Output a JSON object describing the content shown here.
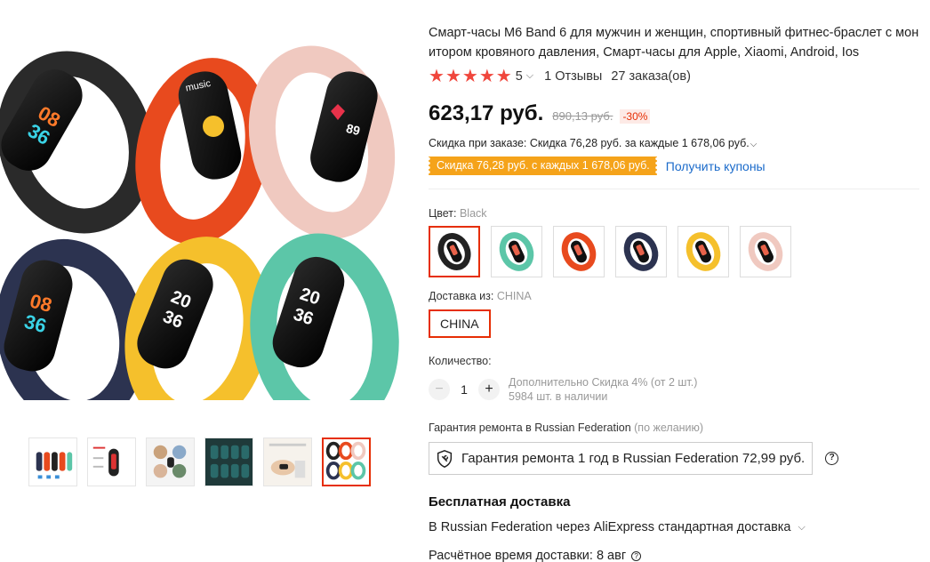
{
  "product": {
    "title": "Смарт-часы M6 Band 6 для мужчин и женщин, спортивный фитнес-браслет с мониторинг кровяного давления, Смарт-часы для Apple, Xiaomi, Android, Ios",
    "title_line1": "Смарт-часы M6 Band 6 для мужчин и женщин, спортивный фитнес-браслет с мон",
    "title_line2": "итором кровяного давления, Смарт-часы для Apple, Xiaomi, Android, Ios",
    "rating": "5",
    "reviews": "1 Отзывы",
    "orders": "27 заказа(ов)"
  },
  "price": {
    "current": "623,17 руб.",
    "old": "890,13 руб.",
    "discount": "-30%"
  },
  "order_discount": "Скидка при заказе: Скидка 76,28 руб. за каждые 1 678,06 руб.",
  "coupon": {
    "tag": "Скидка 76,28 руб. с каждых 1 678,06 руб.",
    "link": "Получить купоны"
  },
  "color": {
    "label": "Цвет:",
    "selected": "Black",
    "options": [
      "Black",
      "Mint",
      "Orange",
      "Navy",
      "Yellow",
      "Pink"
    ],
    "colors": [
      "#222222",
      "#5cc6a8",
      "#e84a1e",
      "#2c3350",
      "#f5c02c",
      "#f0c9c0"
    ]
  },
  "shipping_from": {
    "label": "Доставка из:",
    "selected": "CHINA",
    "option": "CHINA"
  },
  "quantity": {
    "label": "Количество:",
    "value": "1",
    "minus": "−",
    "plus": "+",
    "bulk_discount": "Дополнительно Скидка 4% (от 2 шт.)",
    "stock": "5984 шт. в наличии"
  },
  "warranty": {
    "label": "Гарантия ремонта в Russian Federation",
    "optional": "(по желанию)",
    "option": "Гарантия ремонта 1 год в Russian Federation 72,99 руб.",
    "help": "?"
  },
  "delivery": {
    "free": "Бесплатная доставка",
    "method": "В Russian Federation через AliExpress стандартная доставка",
    "estimate": "Расчётное время доставки: 8 авг"
  },
  "gallery": {
    "thumbnails": 6,
    "active_index": 5
  },
  "icons": {
    "star": "star-icon",
    "chevron": "chevron-down-icon",
    "shield": "shield-wrench-icon",
    "help": "question-icon"
  }
}
